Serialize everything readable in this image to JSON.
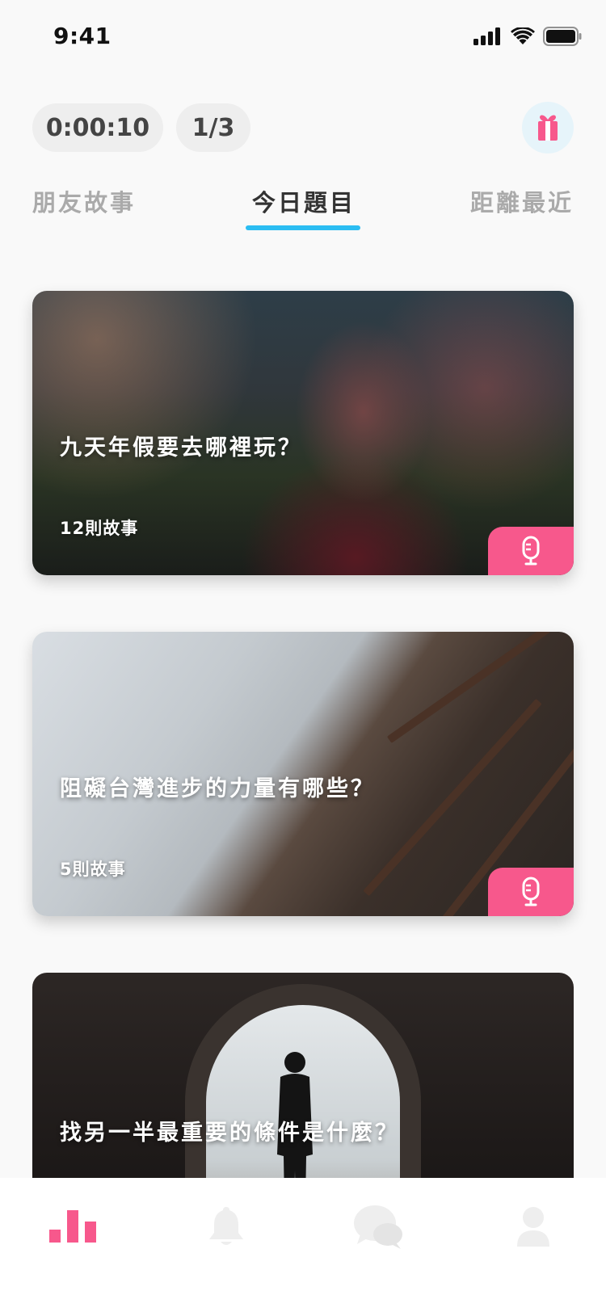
{
  "status_bar": {
    "time": "9:41"
  },
  "header": {
    "timer": "0:00:10",
    "progress": "1/3"
  },
  "tabs": [
    {
      "label": "朋友故事",
      "active": false
    },
    {
      "label": "今日題目",
      "active": true
    },
    {
      "label": "距離最近",
      "active": false
    }
  ],
  "topics": [
    {
      "title": "九天年假要去哪裡玩？",
      "count": "12則故事"
    },
    {
      "title": "阻礙台灣進步的力量有哪些？",
      "count": "5則故事"
    },
    {
      "title": "找另一半最重要的條件是什麼？"
    }
  ],
  "colors": {
    "accent_pink": "#f7588c",
    "tab_underline": "#2bbdf2",
    "gift_bg": "#e6f4fa"
  },
  "icons": {
    "gift": "gift-icon",
    "mic": "microphone-icon",
    "nav": [
      "bar-chart-icon",
      "bell-icon",
      "chat-bubbles-icon",
      "person-icon"
    ]
  }
}
